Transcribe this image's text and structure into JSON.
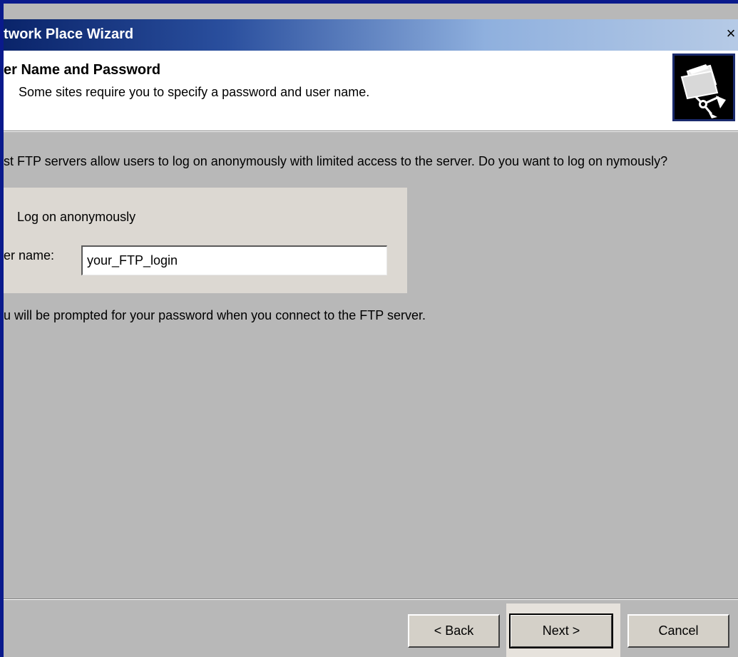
{
  "window": {
    "title": "twork Place Wizard",
    "close_label": "×"
  },
  "header": {
    "title": "er Name and Password",
    "subtitle": "Some sites require you to specify a password and user name."
  },
  "body": {
    "question": "st FTP servers allow users to log on anonymously with limited access to the server.  Do you want to log on nymously?",
    "anonymous_checkbox": {
      "label": "Log on anonymously",
      "checked": false
    },
    "user_name": {
      "label": "er name:",
      "value": "your_FTP_login"
    },
    "note": "u will be prompted for your password when you connect to the FTP server."
  },
  "footer": {
    "back_label": "< Back",
    "next_label": "Next >",
    "cancel_label": "Cancel"
  },
  "colors": {
    "window_border": "#0a1a8c",
    "dialog_bg": "#b8b8b8",
    "title_gradient_start": "#0a246a",
    "title_gradient_end": "#b7cbe6"
  },
  "icons": {
    "wizard_icon": "network-folder-icon"
  }
}
